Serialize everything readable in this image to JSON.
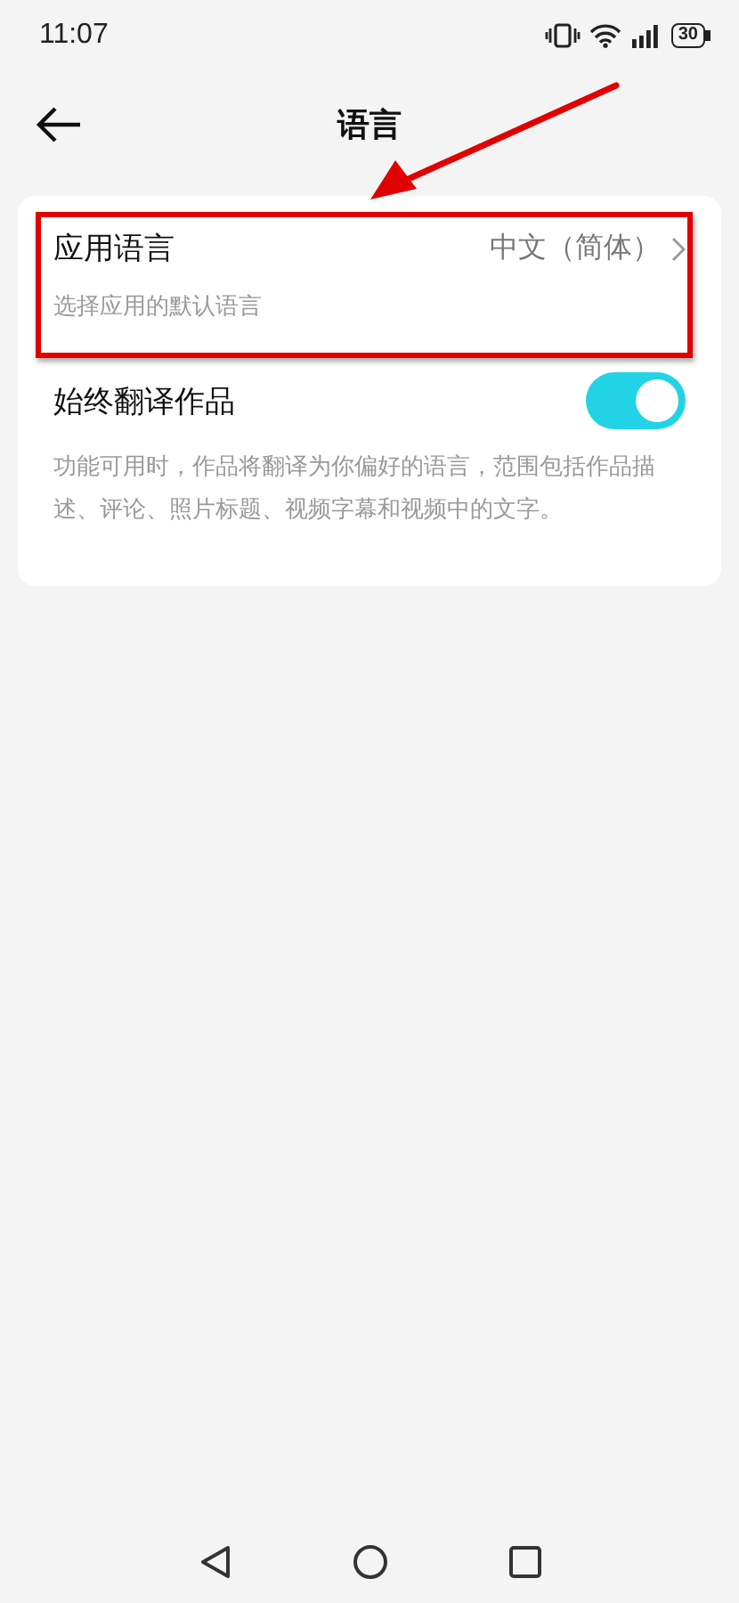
{
  "status_bar": {
    "time": "11:07",
    "battery": "30"
  },
  "header": {
    "title": "语言"
  },
  "settings": [
    {
      "kind": "link",
      "title": "应用语言",
      "value": "中文（简体）",
      "subtitle": "选择应用的默认语言",
      "highlighted": true
    },
    {
      "kind": "toggle",
      "title": "始终翻译作品",
      "on": true,
      "subtitle": "功能可用时，作品将翻译为你偏好的语言，范围包括作品描述、评论、照片标题、视频字幕和视频中的文字。"
    }
  ]
}
